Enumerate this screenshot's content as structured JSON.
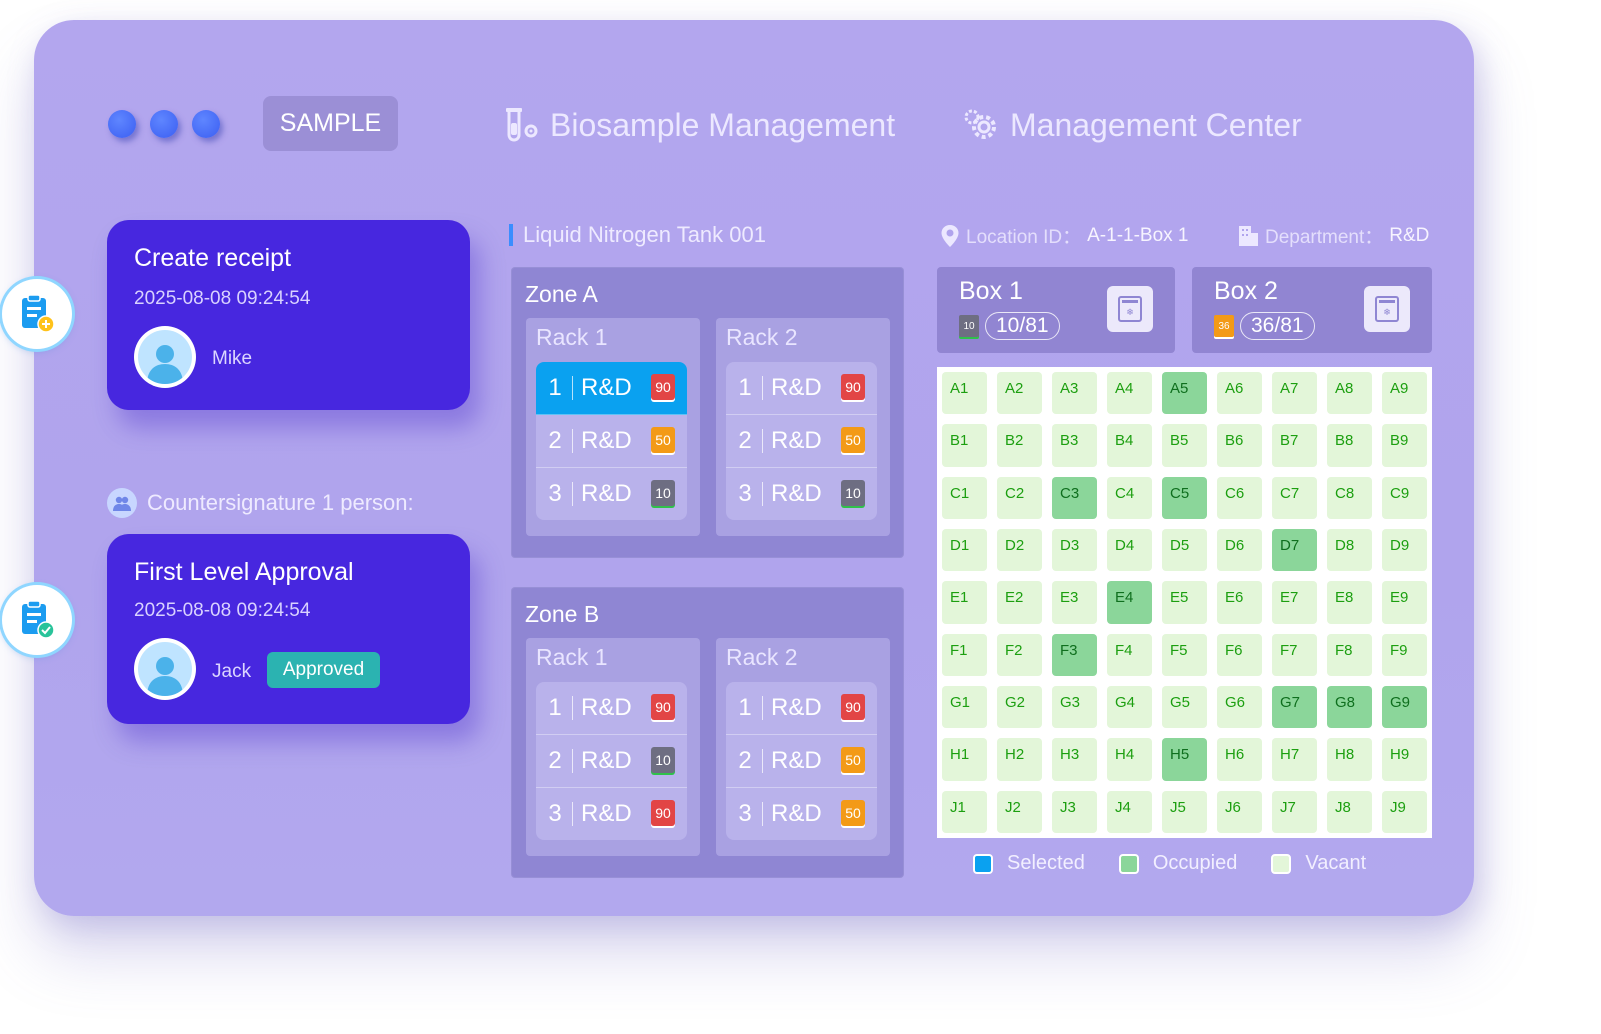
{
  "header": {
    "sample_label": "SAMPLE",
    "nav": [
      {
        "label": "Biosample Management",
        "icon": "test-tube-gear-icon"
      },
      {
        "label": "Management Center",
        "icon": "gears-icon"
      }
    ]
  },
  "receipt_card": {
    "title": "Create receipt",
    "date": "2025-08-08 09:24:54",
    "name": "Mike",
    "icon": "clipboard-add-icon"
  },
  "countersignature": {
    "label": "Countersignature 1 person:"
  },
  "approval_card": {
    "title": "First Level Approval",
    "date": "2025-08-08 09:24:54",
    "name": "Jack",
    "status": "Approved",
    "icon": "clipboard-check-icon"
  },
  "tank": {
    "title": "Liquid Nitrogen Tank 001",
    "zones": [
      {
        "label": "Zone A",
        "racks": [
          {
            "label": "Rack 1",
            "rows": [
              {
                "num": "1",
                "dept": "R&D",
                "badge": "90",
                "selected": true
              },
              {
                "num": "2",
                "dept": "R&D",
                "badge": "50"
              },
              {
                "num": "3",
                "dept": "R&D",
                "badge": "10"
              }
            ]
          },
          {
            "label": "Rack 2",
            "rows": [
              {
                "num": "1",
                "dept": "R&D",
                "badge": "90"
              },
              {
                "num": "2",
                "dept": "R&D",
                "badge": "50"
              },
              {
                "num": "3",
                "dept": "R&D",
                "badge": "10"
              }
            ]
          }
        ]
      },
      {
        "label": "Zone B",
        "racks": [
          {
            "label": "Rack 1",
            "rows": [
              {
                "num": "1",
                "dept": "R&D",
                "badge": "90"
              },
              {
                "num": "2",
                "dept": "R&D",
                "badge": "10"
              },
              {
                "num": "3",
                "dept": "R&D",
                "badge": "90"
              }
            ]
          },
          {
            "label": "Rack 2",
            "rows": [
              {
                "num": "1",
                "dept": "R&D",
                "badge": "90"
              },
              {
                "num": "2",
                "dept": "R&D",
                "badge": "50"
              },
              {
                "num": "3",
                "dept": "R&D",
                "badge": "50"
              }
            ]
          }
        ]
      }
    ]
  },
  "location": {
    "label": "Location ID：",
    "value": "A-1-1-Box 1",
    "dept_label": "Department：",
    "dept_value": "R&D"
  },
  "boxes": [
    {
      "title": "Box 1",
      "badge": "10",
      "count": "10/81"
    },
    {
      "title": "Box 2",
      "badge": "36",
      "count": "36/81"
    }
  ],
  "grid": {
    "rows": [
      "A",
      "B",
      "C",
      "D",
      "E",
      "F",
      "G",
      "H",
      "J"
    ],
    "cols": [
      "1",
      "2",
      "3",
      "4",
      "5",
      "6",
      "7",
      "8",
      "9"
    ],
    "occupied": [
      "A5",
      "C3",
      "C5",
      "D7",
      "E4",
      "F3",
      "G7",
      "G8",
      "G9",
      "H5"
    ]
  },
  "legend": [
    {
      "label": "Selected",
      "color": "#0aa1f0"
    },
    {
      "label": "Occupied",
      "color": "#8bd69a"
    },
    {
      "label": "Vacant",
      "color": "#e3f6d9"
    }
  ],
  "colors": {
    "badge_90": "#e24545",
    "badge_50": "#f39a17",
    "badge_10": "#6e6e82",
    "badge_36": "#f39a17"
  }
}
